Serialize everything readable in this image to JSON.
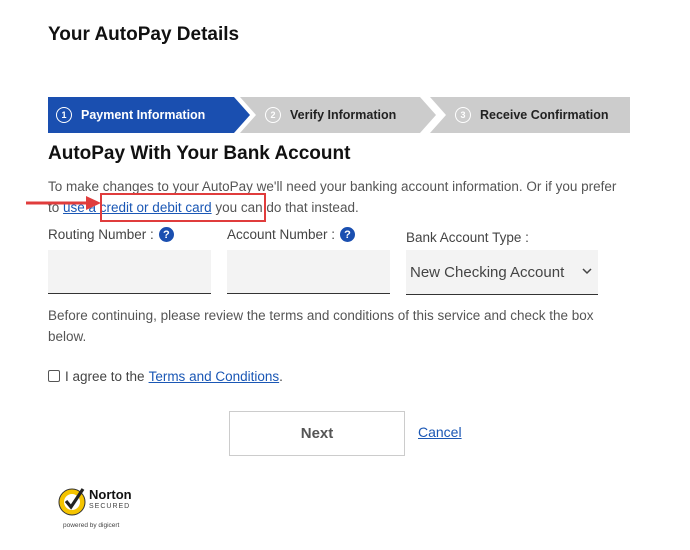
{
  "page": {
    "title": "Your AutoPay Details"
  },
  "stepper": {
    "steps": [
      {
        "number": "1",
        "label": "Payment Information"
      },
      {
        "number": "2",
        "label": "Verify Information"
      },
      {
        "number": "3",
        "label": "Receive Confirmation"
      }
    ],
    "active_step": 1,
    "colors": {
      "active": "#1a4fb0",
      "inactive": "#cccccc"
    }
  },
  "section": {
    "title": "AutoPay With Your Bank Account",
    "intro_before": "To make changes to your AutoPay we'll need your banking account information. Or if you prefer to ",
    "intro_link": "use a credit or debit card",
    "intro_after": " you can do that instead."
  },
  "form": {
    "routing_label": "Routing Number :",
    "account_label": "Account Number :",
    "bank_type_label": "Bank Account Type :",
    "help_glyph": "?",
    "routing_value": "",
    "account_value": "",
    "bank_type_selected": "New Checking Account"
  },
  "terms": {
    "note": "Before continuing, please review the terms and conditions of this service and check the box below.",
    "agree_prefix": "I agree to the",
    "agree_link": "Terms and Conditions",
    "agree_suffix": ".",
    "checked": false
  },
  "actions": {
    "next_label": "Next",
    "cancel_label": "Cancel"
  },
  "badge": {
    "brand": "Norton",
    "secured": "SECURED",
    "powered": "powered by digicert"
  },
  "annotation": {
    "highlight_color": "#e03c3c"
  }
}
